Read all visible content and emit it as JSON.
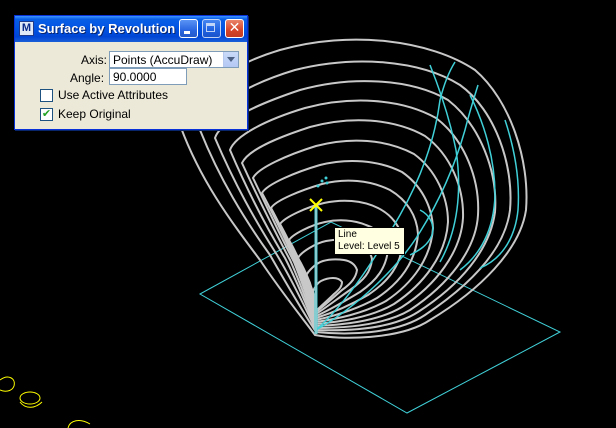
{
  "dialog": {
    "title": "Surface by Revolution",
    "app_icon_glyph": "M",
    "title_buttons": [
      "minimize-icon",
      "maximize-icon",
      "close-icon"
    ],
    "axis_label": "Axis:",
    "axis_value": "Points (AccuDraw)",
    "angle_label": "Angle:",
    "angle_value": "90.0000",
    "use_active_attributes_label": "Use Active Attributes",
    "use_active_attributes_checked": false,
    "keep_original_label": "Keep Original",
    "keep_original_checked": true
  },
  "tooltip": {
    "line1": "Line",
    "line2": "Level: Level 5"
  },
  "colors": {
    "background": "#000000",
    "surface_rings": "#c8c8c8",
    "construction": "#40d0d8",
    "cursor": "#ffff00",
    "stray_geometry": "#ffff00"
  }
}
